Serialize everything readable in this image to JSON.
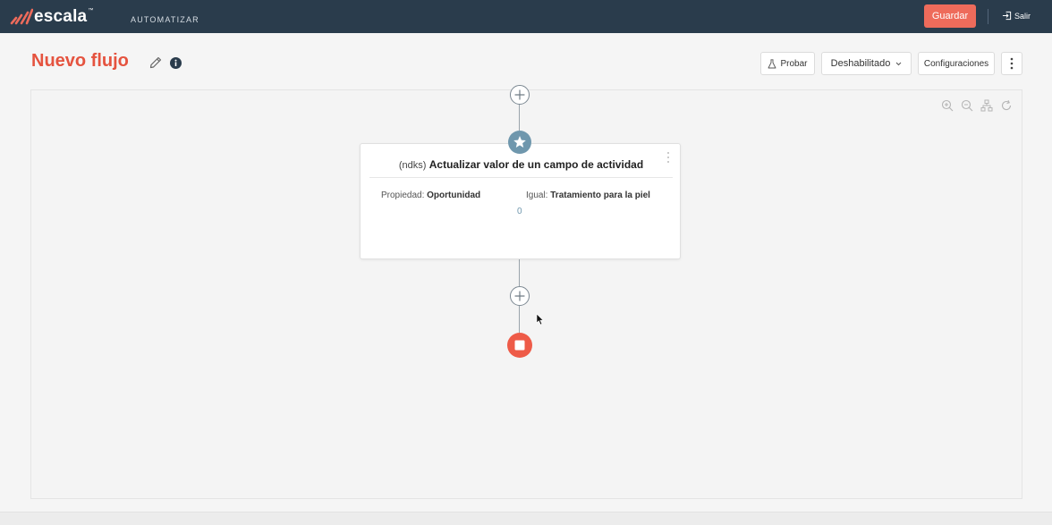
{
  "header": {
    "brand": "escala",
    "brand_tm": "™",
    "app_name": "AUTOMATIZAR",
    "save_label": "Guardar",
    "logout_label": "Salir"
  },
  "toolbar": {
    "title": "Nuevo flujo",
    "test_label": "Probar",
    "status_label": "Deshabilitado",
    "settings_label": "Configuraciones"
  },
  "action_card": {
    "prefix": "(ndks)",
    "action": "Actualizar valor de un campo de actividad",
    "property_label": "Propiedad:",
    "property_value": "Oportunidad",
    "equals_label": "Igual:",
    "equals_value": "Tratamiento para la piel",
    "count": "0"
  },
  "colors": {
    "topbar": "#2a3c4c",
    "accent": "#ee6b5b",
    "title": "#e5533f",
    "trigger": "#6f97ad",
    "stop": "#ee5b48"
  },
  "icons": [
    "logo-icon",
    "logout-icon",
    "pencil-icon",
    "info-icon",
    "flask-icon",
    "chevron-down-icon",
    "more-vertical-icon",
    "zoom-in-icon",
    "zoom-out-icon",
    "layout-tree-icon",
    "refresh-icon",
    "plus-icon",
    "star-icon",
    "stop-icon",
    "mouse-cursor-icon"
  ]
}
